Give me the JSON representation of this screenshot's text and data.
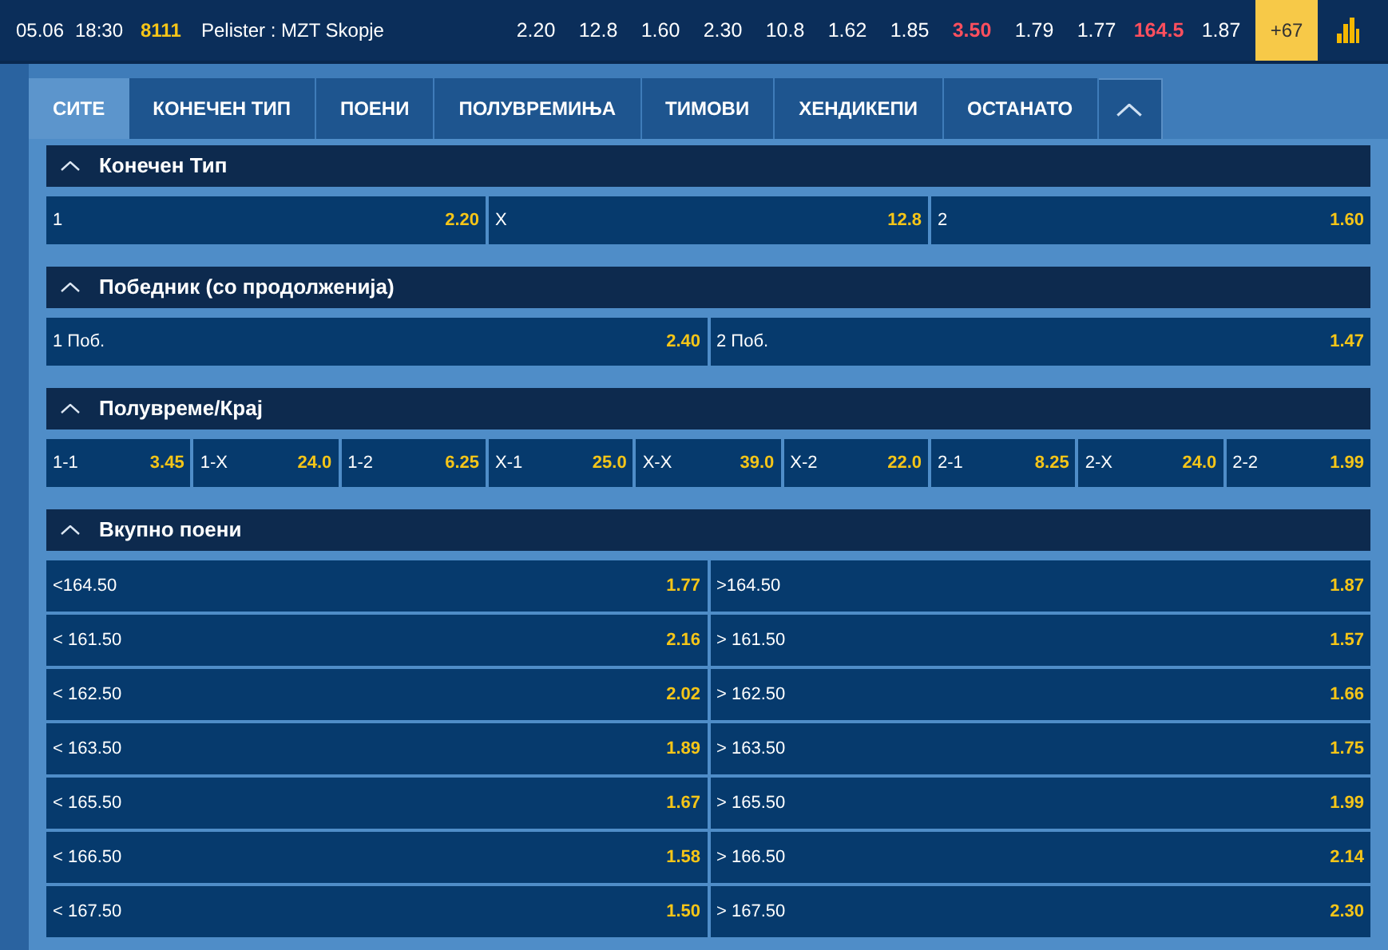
{
  "match": {
    "date": "05.06",
    "time": "18:30",
    "code": "8111",
    "teams": "Pelister : MZT Skopje",
    "odds": [
      {
        "value": "2.20",
        "color": "#ffffff"
      },
      {
        "value": "12.8",
        "color": "#ffffff"
      },
      {
        "value": "1.60",
        "color": "#ffffff"
      },
      {
        "value": "2.30",
        "color": "#ffffff"
      },
      {
        "value": "10.8",
        "color": "#ffffff"
      },
      {
        "value": "1.62",
        "color": "#ffffff"
      },
      {
        "value": "1.85",
        "color": "#ffffff"
      },
      {
        "value": "3.50",
        "color": "#ff4f5e"
      },
      {
        "value": "1.79",
        "color": "#ffffff"
      },
      {
        "value": "1.77",
        "color": "#ffffff"
      },
      {
        "value": "164.5",
        "color": "#ff4f5e"
      },
      {
        "value": "1.87",
        "color": "#ffffff"
      }
    ],
    "more": "+67"
  },
  "tabs": [
    {
      "label": "СИТЕ",
      "selected": true
    },
    {
      "label": "КОНЕЧЕН ТИП",
      "selected": false
    },
    {
      "label": "ПОЕНИ",
      "selected": false
    },
    {
      "label": "ПОЛУВРЕМИЊА",
      "selected": false
    },
    {
      "label": "ТИМОВИ",
      "selected": false
    },
    {
      "label": "ХЕНДИКЕПИ",
      "selected": false
    },
    {
      "label": "ОСТАНАТО",
      "selected": false
    }
  ],
  "sections": [
    {
      "title": "Конечен Тип",
      "expanded": true,
      "kind": "three-way",
      "outcomes": [
        {
          "label": "1",
          "odds": "2.20"
        },
        {
          "label": "X",
          "odds": "12.8"
        },
        {
          "label": "2",
          "odds": "1.60"
        }
      ]
    },
    {
      "title": "Победник (со продолженија)",
      "expanded": true,
      "kind": "two-way",
      "outcomes": [
        {
          "label": "1 Поб.",
          "odds": "2.40"
        },
        {
          "label": "2 Поб.",
          "odds": "1.47"
        }
      ]
    },
    {
      "title": "Полувреме/Крај",
      "expanded": true,
      "kind": "nine-way",
      "outcomes": [
        {
          "label": "1-1",
          "odds": "3.45"
        },
        {
          "label": "1-X",
          "odds": "24.0"
        },
        {
          "label": "1-2",
          "odds": "6.25"
        },
        {
          "label": "X-1",
          "odds": "25.0"
        },
        {
          "label": "X-X",
          "odds": "39.0"
        },
        {
          "label": "X-2",
          "odds": "22.0"
        },
        {
          "label": "2-1",
          "odds": "8.25"
        },
        {
          "label": "2-X",
          "odds": "24.0"
        },
        {
          "label": "2-2",
          "odds": "1.99"
        }
      ]
    },
    {
      "title": "Вкупно поени",
      "expanded": true,
      "kind": "list",
      "outcomes": [
        {
          "label": "<164.50",
          "odds": "1.77"
        },
        {
          "label": ">164.50",
          "odds": "1.87"
        },
        {
          "label": "< 161.50",
          "odds": "2.16"
        },
        {
          "label": "> 161.50",
          "odds": "1.57"
        },
        {
          "label": "< 162.50",
          "odds": "2.02"
        },
        {
          "label": "> 162.50",
          "odds": "1.66"
        },
        {
          "label": "< 163.50",
          "odds": "1.89"
        },
        {
          "label": "> 163.50",
          "odds": "1.75"
        },
        {
          "label": "< 165.50",
          "odds": "1.67"
        },
        {
          "label": "> 165.50",
          "odds": "1.99"
        },
        {
          "label": "< 166.50",
          "odds": "1.58"
        },
        {
          "label": "> 166.50",
          "odds": "2.14"
        },
        {
          "label": "< 167.50",
          "odds": "1.50"
        },
        {
          "label": "> 167.50",
          "odds": "2.30"
        }
      ]
    }
  ]
}
